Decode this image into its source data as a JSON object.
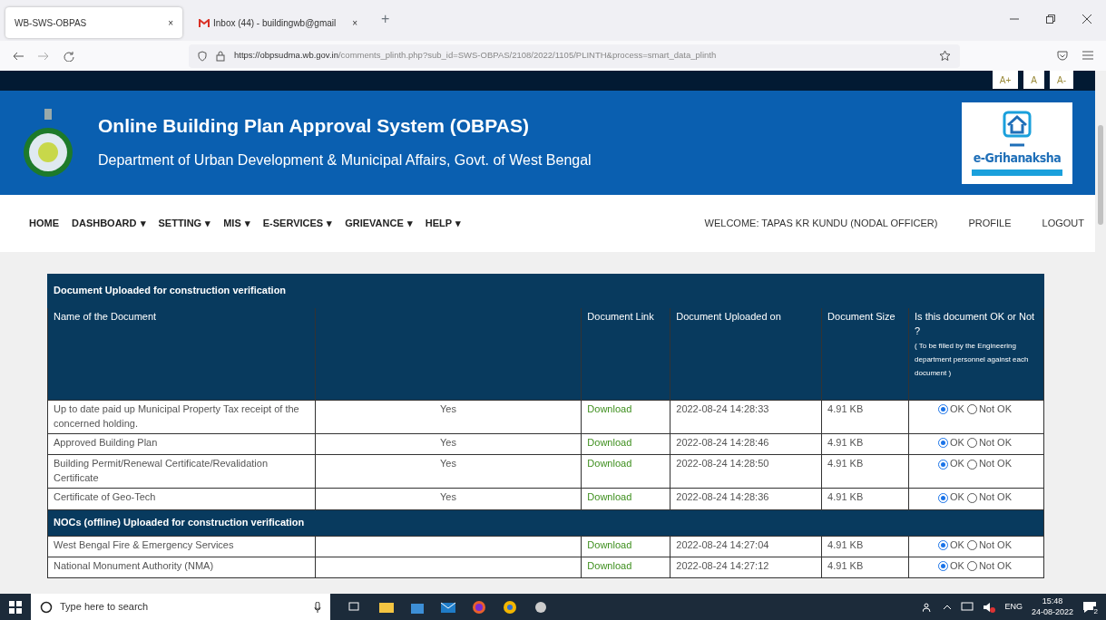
{
  "browser": {
    "tabs": [
      {
        "title": "WB-SWS-OBPAS",
        "selected": true,
        "close": "×",
        "kind": "plain"
      },
      {
        "title": "Inbox (44) - buildingwb@gmail",
        "selected": false,
        "close": "×",
        "kind": "mail"
      }
    ],
    "new_tab": "+",
    "url_host": "https://obpsudma.wb.gov.in",
    "url_path": "/comments_plinth.php?sub_id=SWS-OBPAS/2108/2022/1105/PLINTH&process=smart_data_plinth"
  },
  "font_buttons": [
    "A+",
    "A",
    "A-"
  ],
  "header": {
    "title": "Online Building Plan Approval System (OBPAS)",
    "subtitle": "Department of Urban Development & Municipal Affairs, Govt. of West Bengal",
    "logo_text": "e-Grihanaksha"
  },
  "nav": {
    "items": [
      {
        "label": "HOME",
        "dropdown": false
      },
      {
        "label": "DASHBOARD",
        "dropdown": true
      },
      {
        "label": "SETTING",
        "dropdown": true
      },
      {
        "label": "MIS",
        "dropdown": true
      },
      {
        "label": "E-SERVICES",
        "dropdown": true
      },
      {
        "label": "GRIEVANCE",
        "dropdown": true
      },
      {
        "label": "HELP",
        "dropdown": true
      }
    ],
    "caret": "▾",
    "welcome": "WELCOME: TAPAS KR KUNDU (NODAL OFFICER)",
    "right_links": [
      "PROFILE",
      "LOGOUT"
    ]
  },
  "table": {
    "title": "Document Uploaded for construction verification",
    "columns": [
      "Name of the Document",
      "",
      "Document Link",
      "Document Uploaded on",
      "Document Size",
      "Is this document OK or Not ?"
    ],
    "column_note": "( To be filled by the Engineering department personnel against each document )",
    "rows": [
      {
        "kind": "doc",
        "name": "Up to date paid up Municipal Property Tax receipt of the concerned holding.",
        "column_2": "Yes",
        "link": "Download",
        "uploaded": "2022-08-24 14:28:33",
        "size": "4.91 KB",
        "options": [
          {
            "label": "OK",
            "selected": true
          },
          {
            "label": "Not OK",
            "selected": false
          }
        ]
      },
      {
        "kind": "doc",
        "name": "Approved Building Plan",
        "column_2": "Yes",
        "link": "Download",
        "uploaded": "2022-08-24 14:28:46",
        "size": "4.91 KB",
        "options": [
          {
            "label": "OK",
            "selected": true
          },
          {
            "label": "Not OK",
            "selected": false
          }
        ]
      },
      {
        "kind": "doc",
        "name": "Building Permit/Renewal Certificate/Revalidation Certificate",
        "column_2": "Yes",
        "link": "Download",
        "uploaded": "2022-08-24 14:28:50",
        "size": "4.91 KB",
        "options": [
          {
            "label": "OK",
            "selected": true
          },
          {
            "label": "Not OK",
            "selected": false
          }
        ]
      },
      {
        "kind": "doc",
        "name": "Certificate of Geo-Tech",
        "column_2": "Yes",
        "link": "Download",
        "uploaded": "2022-08-24 14:28:36",
        "size": "4.91 KB",
        "options": [
          {
            "label": "OK",
            "selected": true
          },
          {
            "label": "Not OK",
            "selected": false
          }
        ]
      },
      {
        "kind": "section",
        "name": "NOCs (offline) Uploaded for construction verification"
      },
      {
        "kind": "doc",
        "name": "West Bengal Fire & Emergency Services",
        "column_2": "",
        "link": "Download",
        "uploaded": "2022-08-24 14:27:04",
        "size": "4.91 KB",
        "options": [
          {
            "label": "OK",
            "selected": true
          },
          {
            "label": "Not OK",
            "selected": false
          }
        ]
      },
      {
        "kind": "doc",
        "name": "National Monument Authority (NMA)",
        "column_2": "",
        "link": "Download",
        "uploaded": "2022-08-24 14:27:12",
        "size": "4.91 KB",
        "options": [
          {
            "label": "OK",
            "selected": true
          },
          {
            "label": "Not OK",
            "selected": false
          }
        ]
      }
    ]
  },
  "taskbar": {
    "search_placeholder": "Type here to search",
    "lang": "ENG",
    "time": "15:48",
    "date": "24-08-2022",
    "notifications": "2"
  }
}
